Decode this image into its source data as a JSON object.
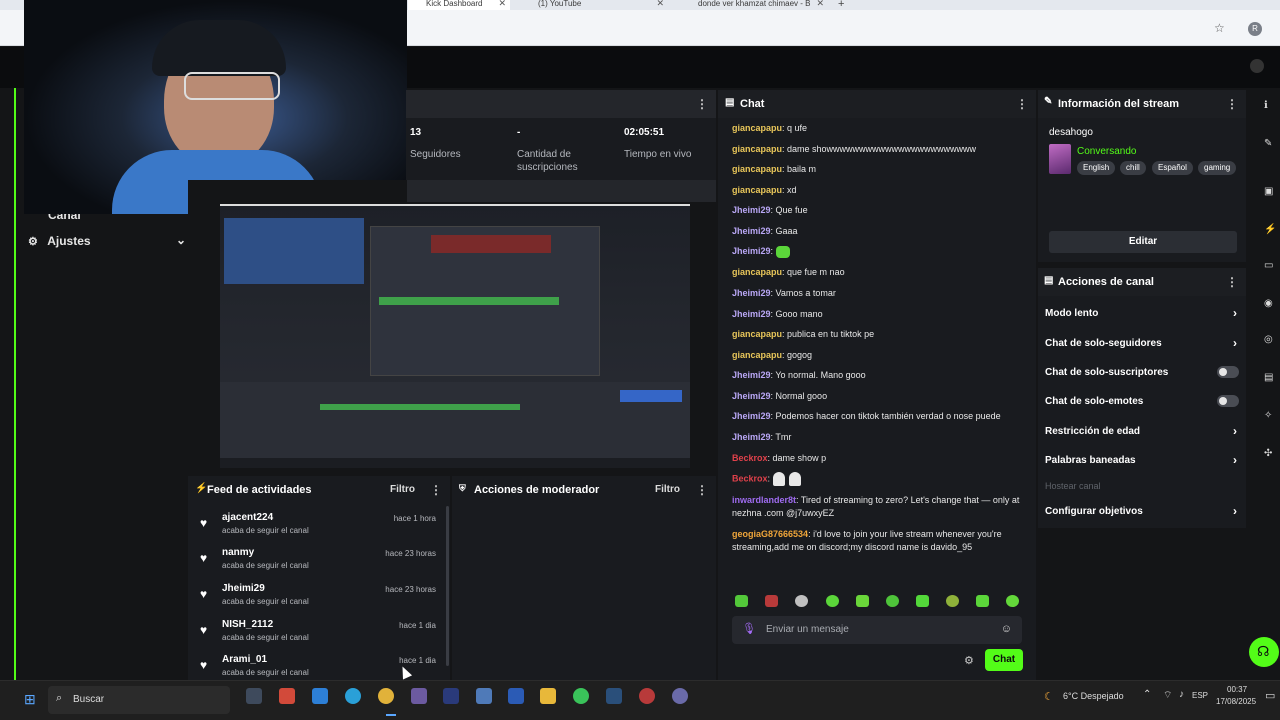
{
  "browser": {
    "tabs": [
      {
        "label": "Kick Dashboard"
      },
      {
        "label": "(1) YouTube"
      },
      {
        "label": "donde ver khamzat chimaev - B"
      }
    ],
    "profile_initial": "R"
  },
  "sidebar": {
    "items": [
      {
        "label": "Canal"
      },
      {
        "label": "Ajustes"
      }
    ]
  },
  "stats": [
    {
      "value": "13",
      "label": "Seguidores"
    },
    {
      "value": "-",
      "label": "Cantidad de suscripciones"
    },
    {
      "value": "02:05:51",
      "label": "Tiempo en vivo"
    }
  ],
  "activity_feed": {
    "title": "Feed de actividades",
    "filter_label": "Filtro",
    "items": [
      {
        "user": "ajacent224",
        "action": "acaba de seguir el canal",
        "time": "hace 1 hora"
      },
      {
        "user": "nanmy",
        "action": "acaba de seguir el canal",
        "time": "hace 23 horas"
      },
      {
        "user": "Jheimi29",
        "action": "acaba de seguir el canal",
        "time": "hace 23 horas"
      },
      {
        "user": "NISH_2112",
        "action": "acaba de seguir el canal",
        "time": "hace 1 dia"
      },
      {
        "user": "Arami_01",
        "action": "acaba de seguir el canal",
        "time": "hace 1 dia"
      }
    ]
  },
  "mod_actions": {
    "title": "Acciones de moderador",
    "filter_label": "Filtro"
  },
  "chat": {
    "title": "Chat",
    "input_placeholder": "Enviar un mensaje",
    "send_label": "Chat",
    "colors": {
      "gianca": "#e8c65a",
      "jheimi": "#b9a7f5",
      "beckrox": "#e0414b",
      "inward": "#9f6cf0",
      "geogia": "#f0a63a"
    },
    "messages": [
      {
        "user": "giancapapu",
        "text": "q ufe",
        "color_key": "gianca"
      },
      {
        "user": "giancapapu",
        "text": "dame showwwwwwwwwwwwwwwwwwwwwww",
        "color_key": "gianca"
      },
      {
        "user": "giancapapu",
        "text": "baila m",
        "color_key": "gianca"
      },
      {
        "user": "giancapapu",
        "text": "xd",
        "color_key": "gianca"
      },
      {
        "user": "Jheimi29",
        "text": "Que fue",
        "color_key": "jheimi"
      },
      {
        "user": "Jheimi29",
        "text": "Gaaa",
        "color_key": "jheimi"
      },
      {
        "user": "Jheimi29",
        "text": "",
        "color_key": "jheimi",
        "emote": "green"
      },
      {
        "user": "giancapapu",
        "text": "que fue m nao",
        "color_key": "gianca"
      },
      {
        "user": "Jheimi29",
        "text": "Vamos a tomar",
        "color_key": "jheimi"
      },
      {
        "user": "Jheimi29",
        "text": "Gooo mano",
        "color_key": "jheimi"
      },
      {
        "user": "giancapapu",
        "text": "publica en tu tiktok pe",
        "color_key": "gianca"
      },
      {
        "user": "giancapapu",
        "text": "gogog",
        "color_key": "gianca"
      },
      {
        "user": "Jheimi29",
        "text": "Yo normal. Mano gooo",
        "color_key": "jheimi"
      },
      {
        "user": "Jheimi29",
        "text": "Normal gooo",
        "color_key": "jheimi"
      },
      {
        "user": "Jheimi29",
        "text": "Podemos hacer con tiktok también verdad o nose puede",
        "color_key": "jheimi"
      },
      {
        "user": "Jheimi29",
        "text": "Tmr",
        "color_key": "jheimi"
      },
      {
        "user": "Beckrox",
        "text": "dame show p",
        "color_key": "beckrox"
      },
      {
        "user": "Beckrox",
        "text": "",
        "color_key": "beckrox",
        "emote": "ghost"
      },
      {
        "user": "inwardlander8t",
        "text": "Tired of streaming to zero? Let's change that — only at nezhna .com @j7uwxyEZ",
        "color_key": "inward"
      },
      {
        "user": "geogiaG87666534",
        "text": "i'd love to join your live stream whenever you're streaming,add me on discord;my discord name is davido_95",
        "color_key": "geogia"
      }
    ]
  },
  "stream_info": {
    "title": "Información del stream",
    "stream_title": "desahogo",
    "category": "Conversando",
    "tags": [
      "English",
      "chill",
      "Español",
      "gaming"
    ],
    "edit_label": "Editar"
  },
  "channel_actions": {
    "title": "Acciones de canal",
    "items": [
      {
        "label": "Modo lento",
        "control": "chevron"
      },
      {
        "label": "Chat de solo-seguidores",
        "control": "chevron"
      },
      {
        "label": "Chat de solo-suscriptores",
        "control": "toggle"
      },
      {
        "label": "Chat de solo-emotes",
        "control": "toggle"
      },
      {
        "label": "Restricción de edad",
        "control": "chevron"
      },
      {
        "label": "Palabras baneadas",
        "control": "chevron"
      },
      {
        "label": "Hostear canal",
        "control": "disabled"
      },
      {
        "label": "Configurar objetivos",
        "control": "chevron"
      }
    ]
  },
  "taskbar": {
    "search_label": "Buscar",
    "weather": "6°C Despejado",
    "lang": "ESP",
    "time": "00:37",
    "date": "17/08/2025"
  },
  "accent_color": "#53fc18"
}
